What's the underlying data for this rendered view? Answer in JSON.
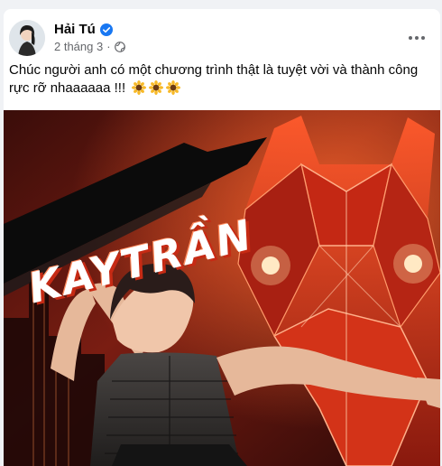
{
  "post": {
    "author": "Hải Tú",
    "date": "2 tháng 3",
    "separator": "·",
    "caption": "Chúc người anh có một chương trình thật là tuyệt vời và thành công rực rỡ nhaaaaaa !!!",
    "emojis": [
      "sunflower-emoji",
      "sunflower-emoji",
      "sunflower-emoji"
    ]
  },
  "poster": {
    "title": "KAYTRẦN"
  },
  "icons": {
    "verified": "verified-badge-icon",
    "audience": "globe-icon",
    "more": "more-options-icon"
  },
  "colors": {
    "verified_blue": "#1877f2",
    "meta_gray": "#65676b",
    "poster_red": "#e0381c",
    "poster_orange": "#ff7a3a"
  }
}
